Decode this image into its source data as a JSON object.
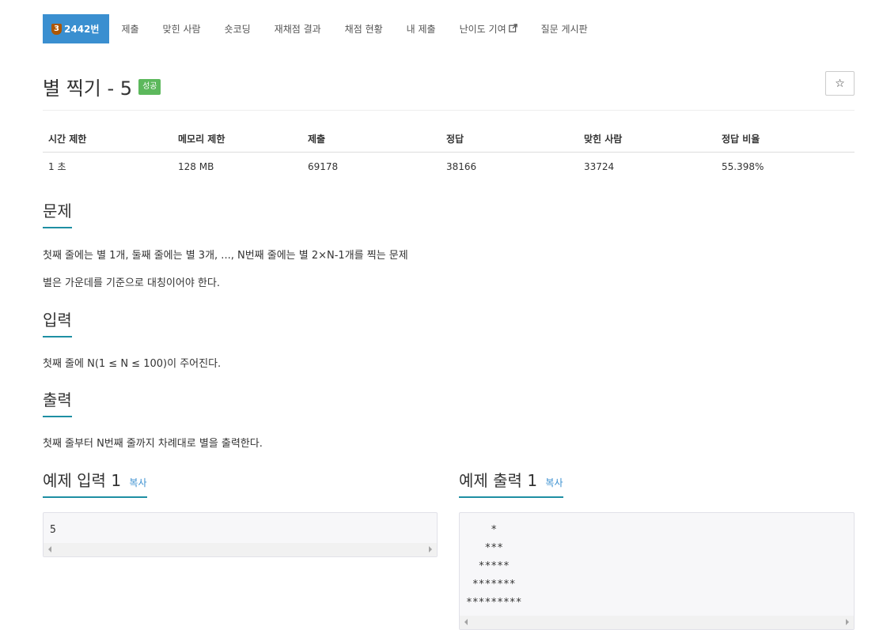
{
  "nav": {
    "problem_tab": {
      "tier": "3",
      "number": "2442번"
    },
    "items": [
      "제출",
      "맞힌 사람",
      "숏코딩",
      "재채점 결과",
      "채점 현황",
      "내 제출",
      "난이도 기여",
      "질문 게시판"
    ]
  },
  "problem": {
    "title": "별 찍기 - 5",
    "status": "성공",
    "star": "☆"
  },
  "stats": {
    "headers": [
      "시간 제한",
      "메모리 제한",
      "제출",
      "정답",
      "맞힌 사람",
      "정답 비율"
    ],
    "values": [
      "1 초",
      "128 MB",
      "69178",
      "38166",
      "33724",
      "55.398%"
    ]
  },
  "sections": {
    "description_title": "문제",
    "description_lines": [
      "첫째 줄에는 별 1개, 둘째 줄에는 별 3개, ..., N번째 줄에는 별 2×N-1개를 찍는 문제",
      "별은 가운데를 기준으로 대칭이어야 한다."
    ],
    "input_title": "입력",
    "input_text": "첫째 줄에 N(1 ≤ N ≤ 100)이 주어진다.",
    "output_title": "출력",
    "output_text": "첫째 줄부터 N번째 줄까지 차례대로 별을 출력한다."
  },
  "samples": {
    "input_title": "예제 입력 1",
    "output_title": "예제 출력 1",
    "copy_label": "복사",
    "input_value": "5",
    "output_value": "    *\n   ***\n  *****\n *******\n*********"
  },
  "colors": {
    "active_tab": "#3a8fd0",
    "success": "#5cb85c",
    "tier_bronze": "#ad5600",
    "link": "#3a8fd0"
  }
}
